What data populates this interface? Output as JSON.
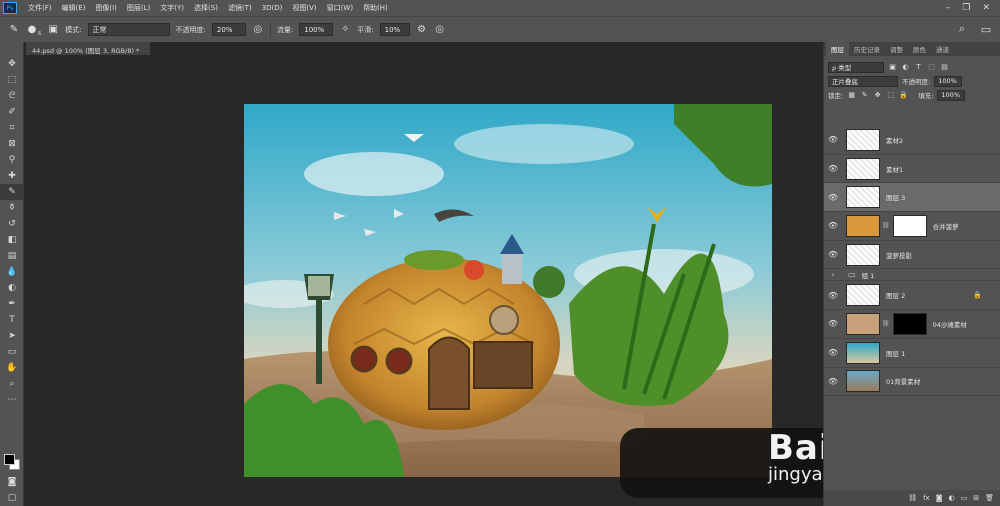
{
  "app": {
    "logo": "Ps"
  },
  "menubar": {
    "items": [
      "文件(F)",
      "编辑(E)",
      "图像(I)",
      "图层(L)",
      "文字(Y)",
      "选择(S)",
      "滤镜(T)",
      "3D(D)",
      "视图(V)",
      "窗口(W)",
      "帮助(H)"
    ],
    "window_controls": [
      "minimize-icon",
      "restore-icon",
      "close-icon"
    ]
  },
  "options": {
    "mode_label": "模式:",
    "mode_value": "正常",
    "opacity_label": "不透明度:",
    "opacity_value": "20%",
    "flow_label": "流量:",
    "flow_value": "100%",
    "smoothing_label": "平滑:",
    "smoothing_value": "10%",
    "brush_size": "6"
  },
  "document": {
    "tab_title": "44.psd @ 100% (图层 3, RGB/8) *"
  },
  "panel": {
    "tabs": [
      "图层",
      "历史记录",
      "调整",
      "颜色",
      "通道"
    ],
    "kind_label": "ρ 类型",
    "blend_mode": "正片叠底",
    "opacity_label": "不透明度:",
    "opacity_value": "100%",
    "lock_label": "锁定:",
    "fill_label": "填充:",
    "fill_value": "100%"
  },
  "layers": [
    {
      "name": "素材2",
      "mask": null,
      "selected": false,
      "locked": false
    },
    {
      "name": "素材1",
      "mask": null,
      "selected": false,
      "locked": false
    },
    {
      "name": "图层 3",
      "mask": null,
      "selected": true,
      "locked": false
    },
    {
      "name": "合并菠萝",
      "mask": "#ffffff",
      "selected": false,
      "locked": false
    },
    {
      "name": "菠萝投影",
      "mask": null,
      "selected": false,
      "locked": false
    },
    {
      "name": "组 1",
      "group": true
    },
    {
      "name": "图层 2",
      "mask": null,
      "selected": false,
      "locked": true
    },
    {
      "name": "04沙滩素材",
      "mask": "#000000",
      "selected": false,
      "locked": false
    },
    {
      "name": "图层 1",
      "mask": null,
      "selected": false,
      "locked": false
    },
    {
      "name": "01背景素材",
      "mask": null,
      "selected": false,
      "locked": false
    }
  ],
  "watermark": {
    "main": "Bai 经验",
    "sub": "jingyan.baidu.com"
  },
  "colors": {
    "panel_bg": "#535353",
    "workspace_bg": "#282828",
    "accent": "#31a8ff"
  }
}
